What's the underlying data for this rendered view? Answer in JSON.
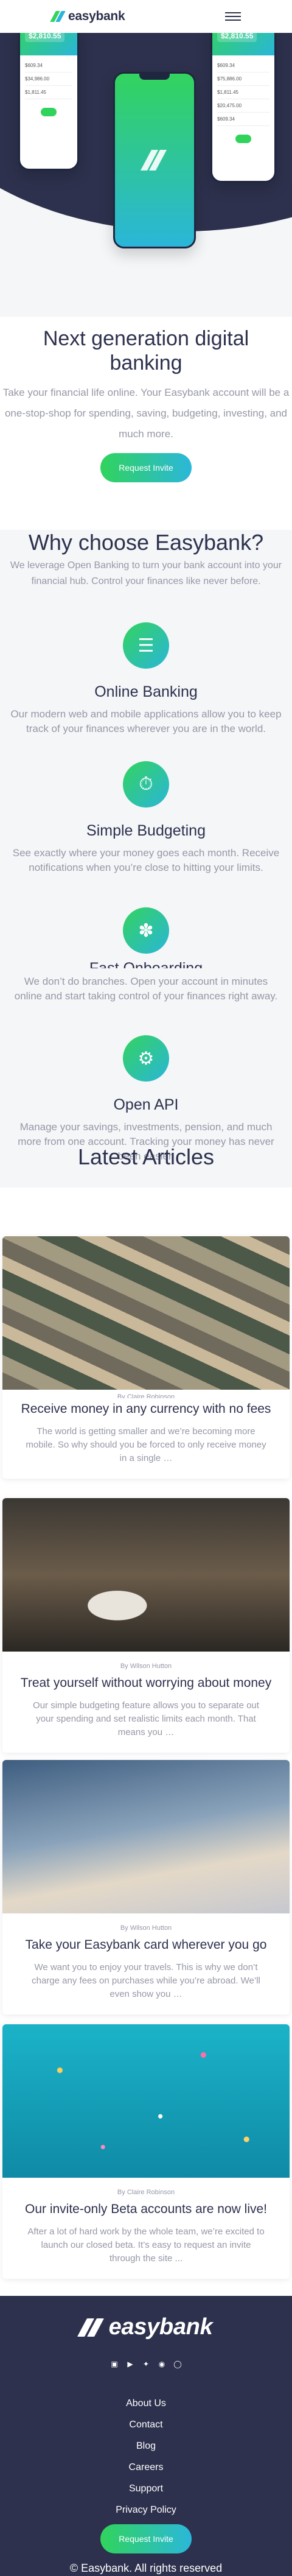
{
  "header": {
    "brand": "easybank",
    "menu_icon": "hamburger-icon"
  },
  "hero": {
    "phones": [
      {
        "balance": "$2,810.55",
        "rows": [
          "$609.34",
          "$34,986.00",
          "$1,811.45"
        ]
      },
      {
        "balance": "$2,810.55",
        "rows": [
          "$609.34",
          "$75,886.00",
          "$1,811.45",
          "$20,475.00",
          "$609.34"
        ]
      }
    ],
    "title": "Next generation digital banking",
    "subtitle": "Take your financial life online. Your Easybank account will be a one-stop-shop for spending, saving, budgeting, investing, and much more.",
    "cta": "Request Invite"
  },
  "why": {
    "title": "Why choose Easybank?",
    "subtitle": "We leverage Open Banking to turn your bank account into your financial hub. Control your finances like never before.",
    "features": [
      {
        "icon": "online-banking-icon",
        "title": "Online Banking",
        "text": "Our modern web and mobile applications allow you to keep track of your finances wherever you are in the world."
      },
      {
        "icon": "budgeting-icon",
        "title": "Simple Budgeting",
        "text": "See exactly where your money goes each month. Receive notifications when you’re close to hitting your limits."
      },
      {
        "icon": "onboarding-icon",
        "title": "Fast Onboarding",
        "text": "We don’t do branches. Open your account in minutes online and start taking control of your finances right away."
      },
      {
        "icon": "api-icon",
        "title": "Open API",
        "text": "Manage your savings, investments, pension, and much more from one account. Tracking your money has never been easier."
      }
    ]
  },
  "articles": {
    "title": "Latest Articles",
    "items": [
      {
        "author": "By Claire Robinson",
        "title": "Receive money in any currency with no fees",
        "text": "The world is getting smaller and we’re becoming more mobile. So why should you be forced to only receive money in a single …"
      },
      {
        "author": "By Wilson Hutton",
        "title": "Treat yourself without worrying about money",
        "text": "Our simple budgeting feature allows you to separate out your spending and set realistic limits each month. That means you …"
      },
      {
        "author": "By Wilson Hutton",
        "title": "Take your Easybank card wherever you go",
        "text": "We want you to enjoy your travels. This is why we don’t charge any fees on purchases while you’re abroad. We’ll even show you …"
      },
      {
        "author": "By Claire Robinson",
        "title": "Our invite-only Beta accounts are now live!",
        "text": "After a lot of hard work by the whole team, we’re excited to launch our closed beta. It’s easy to request an invite through the site ..."
      }
    ]
  },
  "footer": {
    "brand": "easybank",
    "socials": [
      "facebook-icon",
      "youtube-icon",
      "twitter-icon",
      "pinterest-icon",
      "instagram-icon"
    ],
    "links": [
      "About Us",
      "Contact",
      "Blog",
      "Careers",
      "Support",
      "Privacy Policy"
    ],
    "cta": "Request Invite",
    "copyright": "© Easybank. All rights reserved"
  },
  "colors": {
    "dark_blue": "#2d314d",
    "lime_green": "#31d35c",
    "bright_cyan": "#2bb7da",
    "grayish_blue": "#9698a6",
    "light_gray": "#f4f6f8"
  }
}
